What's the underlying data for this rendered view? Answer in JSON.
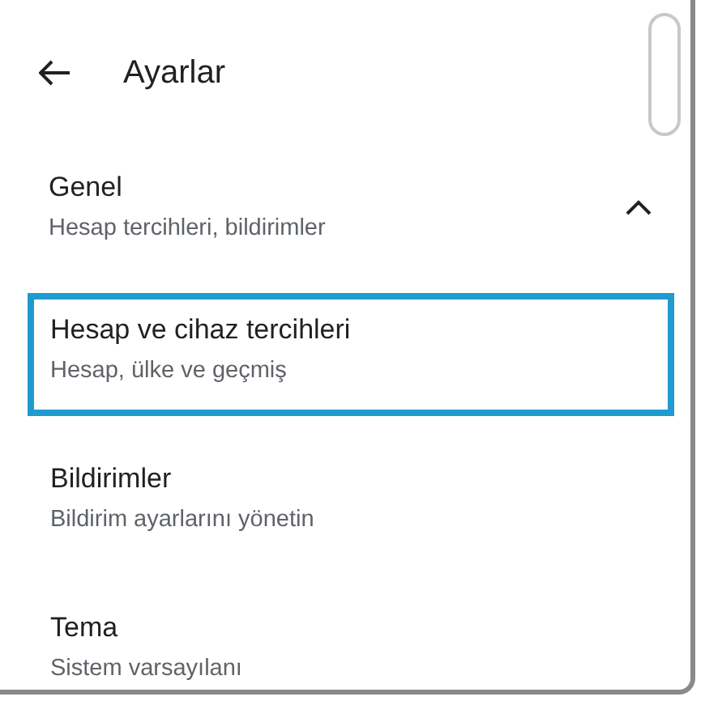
{
  "header": {
    "title": "Ayarlar"
  },
  "section": {
    "title": "Genel",
    "subtitle": "Hesap tercihleri, bildirimler",
    "expanded": true
  },
  "items": [
    {
      "title": "Hesap ve cihaz tercihleri",
      "subtitle": "Hesap, ülke ve geçmiş",
      "selected": true
    },
    {
      "title": "Bildirimler",
      "subtitle": "Bildirim ayarlarını yönetin",
      "selected": false
    },
    {
      "title": "Tema",
      "subtitle": "Sistem varsayılanı",
      "selected": false
    }
  ]
}
